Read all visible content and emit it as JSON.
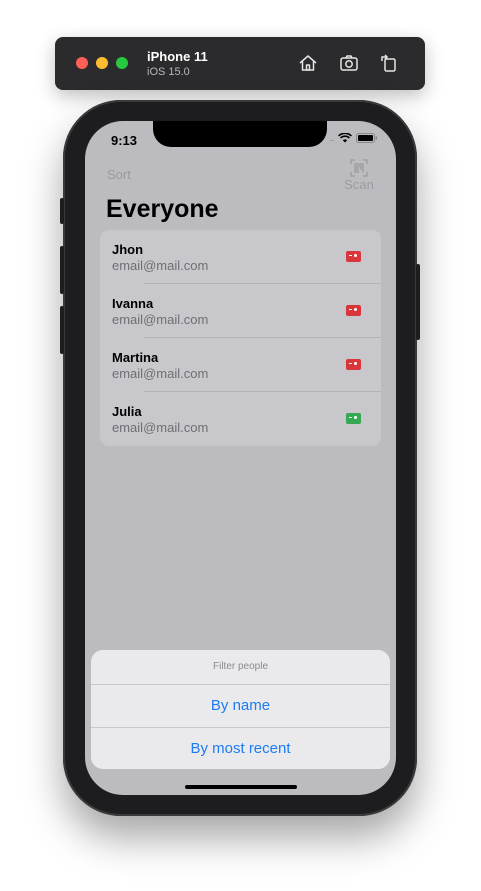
{
  "simulator": {
    "device_name": "iPhone 11",
    "os_version": "iOS 15.0",
    "toolbar_icons": [
      "home-icon",
      "screenshot-icon",
      "rotate-icon"
    ]
  },
  "status_bar": {
    "time": "9:13",
    "signal": "....",
    "icons": [
      "wifi-icon",
      "battery-icon"
    ]
  },
  "nav": {
    "sort_label": "Sort",
    "scan_label": "Scan",
    "scan_icon": "qr-scan-icon"
  },
  "page_title": "Everyone",
  "people": [
    {
      "name": "Jhon",
      "email": "email@mail.com",
      "status_color": "#d8363a"
    },
    {
      "name": "Ivanna",
      "email": "email@mail.com",
      "status_color": "#d8363a"
    },
    {
      "name": "Martina",
      "email": "email@mail.com",
      "status_color": "#d8363a"
    },
    {
      "name": "Julia",
      "email": "email@mail.com",
      "status_color": "#34a853"
    }
  ],
  "action_sheet": {
    "title": "Filter people",
    "options": [
      "By name",
      "By most recent"
    ]
  },
  "colors": {
    "accent": "#1b7cf5",
    "red_card": "#d8363a",
    "green_card": "#34a853"
  }
}
